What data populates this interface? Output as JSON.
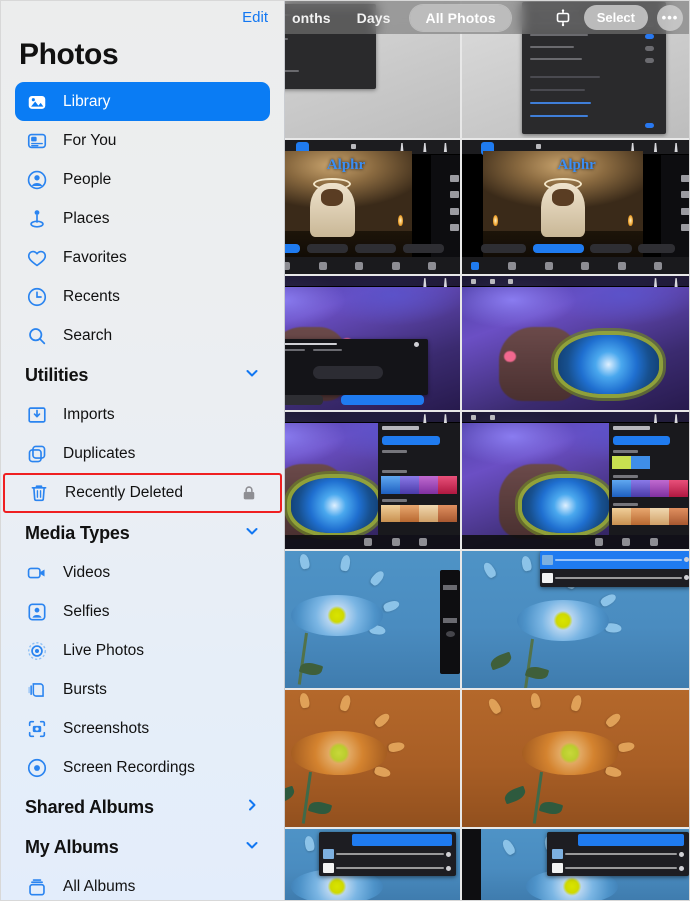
{
  "app": {
    "name": "Photos",
    "platform": "iPadOS"
  },
  "sidebar": {
    "edit_label": "Edit",
    "title": "Photos",
    "items": [
      {
        "label": "Library",
        "icon": "photo-stack-icon",
        "selected": true,
        "group": null
      },
      {
        "label": "For You",
        "icon": "for-you-card-icon",
        "selected": false,
        "group": null
      },
      {
        "label": "People",
        "icon": "person-circle-icon",
        "selected": false,
        "group": null
      },
      {
        "label": "Places",
        "icon": "map-pin-icon",
        "selected": false,
        "group": null
      },
      {
        "label": "Favorites",
        "icon": "heart-icon",
        "selected": false,
        "group": null
      },
      {
        "label": "Recents",
        "icon": "clock-icon",
        "selected": false,
        "group": null
      },
      {
        "label": "Search",
        "icon": "search-icon",
        "selected": false,
        "group": null
      }
    ],
    "sections": [
      {
        "header": "Utilities",
        "chevron": "chevron-down-icon",
        "items": [
          {
            "label": "Imports",
            "icon": "import-tray-icon",
            "trailing": null
          },
          {
            "label": "Duplicates",
            "icon": "duplicate-squares-icon",
            "trailing": null
          },
          {
            "label": "Recently Deleted",
            "icon": "trash-icon",
            "trailing": "lock-icon",
            "highlighted": true
          }
        ]
      },
      {
        "header": "Media Types",
        "chevron": "chevron-down-icon",
        "items": [
          {
            "label": "Videos",
            "icon": "video-camera-icon"
          },
          {
            "label": "Selfies",
            "icon": "selfie-portrait-icon"
          },
          {
            "label": "Live Photos",
            "icon": "live-photo-icon"
          },
          {
            "label": "Bursts",
            "icon": "burst-stack-icon"
          },
          {
            "label": "Screenshots",
            "icon": "screenshot-frame-icon"
          },
          {
            "label": "Screen Recordings",
            "icon": "record-dot-icon"
          }
        ]
      },
      {
        "header": "Shared Albums",
        "chevron": "chevron-right-icon",
        "items": []
      },
      {
        "header": "My Albums",
        "chevron": "chevron-down-icon",
        "items": [
          {
            "label": "All Albums",
            "icon": "albums-stack-icon"
          }
        ]
      }
    ],
    "highlight_color": "#ef1f21",
    "accent_color": "#0a7cf4"
  },
  "toolbar": {
    "segments": [
      {
        "label": "onths",
        "active": false
      },
      {
        "label": "Days",
        "active": false
      },
      {
        "label": "All Photos",
        "active": true
      }
    ],
    "aspect_icon": "zoom-aspect-icon",
    "select_label": "Select",
    "more_label": "•••",
    "more_icon": "more-ellipsis-icon"
  },
  "grid": {
    "rows": [
      {
        "row_name": "row-partial-top",
        "cells": [
          {
            "type": "grey-editor",
            "alt": "Light editor screenshot"
          },
          {
            "type": "grey-panel",
            "alt": "Light editor screenshot with dark dialog"
          },
          {
            "type": "grey-settings",
            "alt": "Light editor screenshot with settings panel"
          }
        ]
      },
      {
        "row_name": "row-candle",
        "cells": [
          {
            "type": "candle-layers",
            "alt": "Dark editor with candle figure and Layers popover"
          },
          {
            "type": "candle-alphr",
            "alt": "Dark editor with candle figure and Alphr text",
            "watermark": "Alphr"
          },
          {
            "type": "candle-alphr2",
            "alt": "Dark editor with candle figure and Alphr text",
            "watermark": "Alphr"
          }
        ]
      },
      {
        "row_name": "row-purple-art",
        "cells": [
          {
            "type": "purple-ref",
            "alt": "Purple haired girl artwork with reference panel"
          },
          {
            "type": "purple-ref2",
            "alt": "Purple haired girl artwork with reference dialog"
          },
          {
            "type": "purple-rose",
            "alt": "Purple haired girl artwork with blue rose pasted"
          }
        ]
      },
      {
        "row_name": "row-palettes",
        "cells": [
          {
            "type": "palette-a",
            "alt": "Artwork with color palettes panel"
          },
          {
            "type": "palette-b",
            "alt": "Artwork with color palettes panel"
          },
          {
            "type": "palette-c",
            "alt": "Artwork with color palettes panel"
          }
        ]
      },
      {
        "row_name": "row-blue-flower",
        "cells": [
          {
            "type": "flower-blue",
            "alt": "Blue paper flower photo"
          },
          {
            "type": "flower-blue-strip",
            "alt": "Blue paper flower photo with tool strip"
          },
          {
            "type": "flower-blue-layers",
            "alt": "Blue paper flower photo with layers panel"
          }
        ]
      },
      {
        "row_name": "row-orange-flower",
        "cells": [
          {
            "type": "flower-blue",
            "alt": "Blue paper flower photo"
          },
          {
            "type": "flower-orange",
            "alt": "Orange paper flower photo"
          },
          {
            "type": "flower-orange",
            "alt": "Orange paper flower photo"
          }
        ]
      },
      {
        "row_name": "row-flower-layers",
        "cells": [
          {
            "type": "flower-panel-a",
            "alt": "Blue flower with blue layer selected panel"
          },
          {
            "type": "flower-panel-b",
            "alt": "Blue flower with layers panel"
          },
          {
            "type": "flower-panel-c",
            "alt": "Blue flower with layers panel and strip"
          }
        ]
      }
    ]
  }
}
